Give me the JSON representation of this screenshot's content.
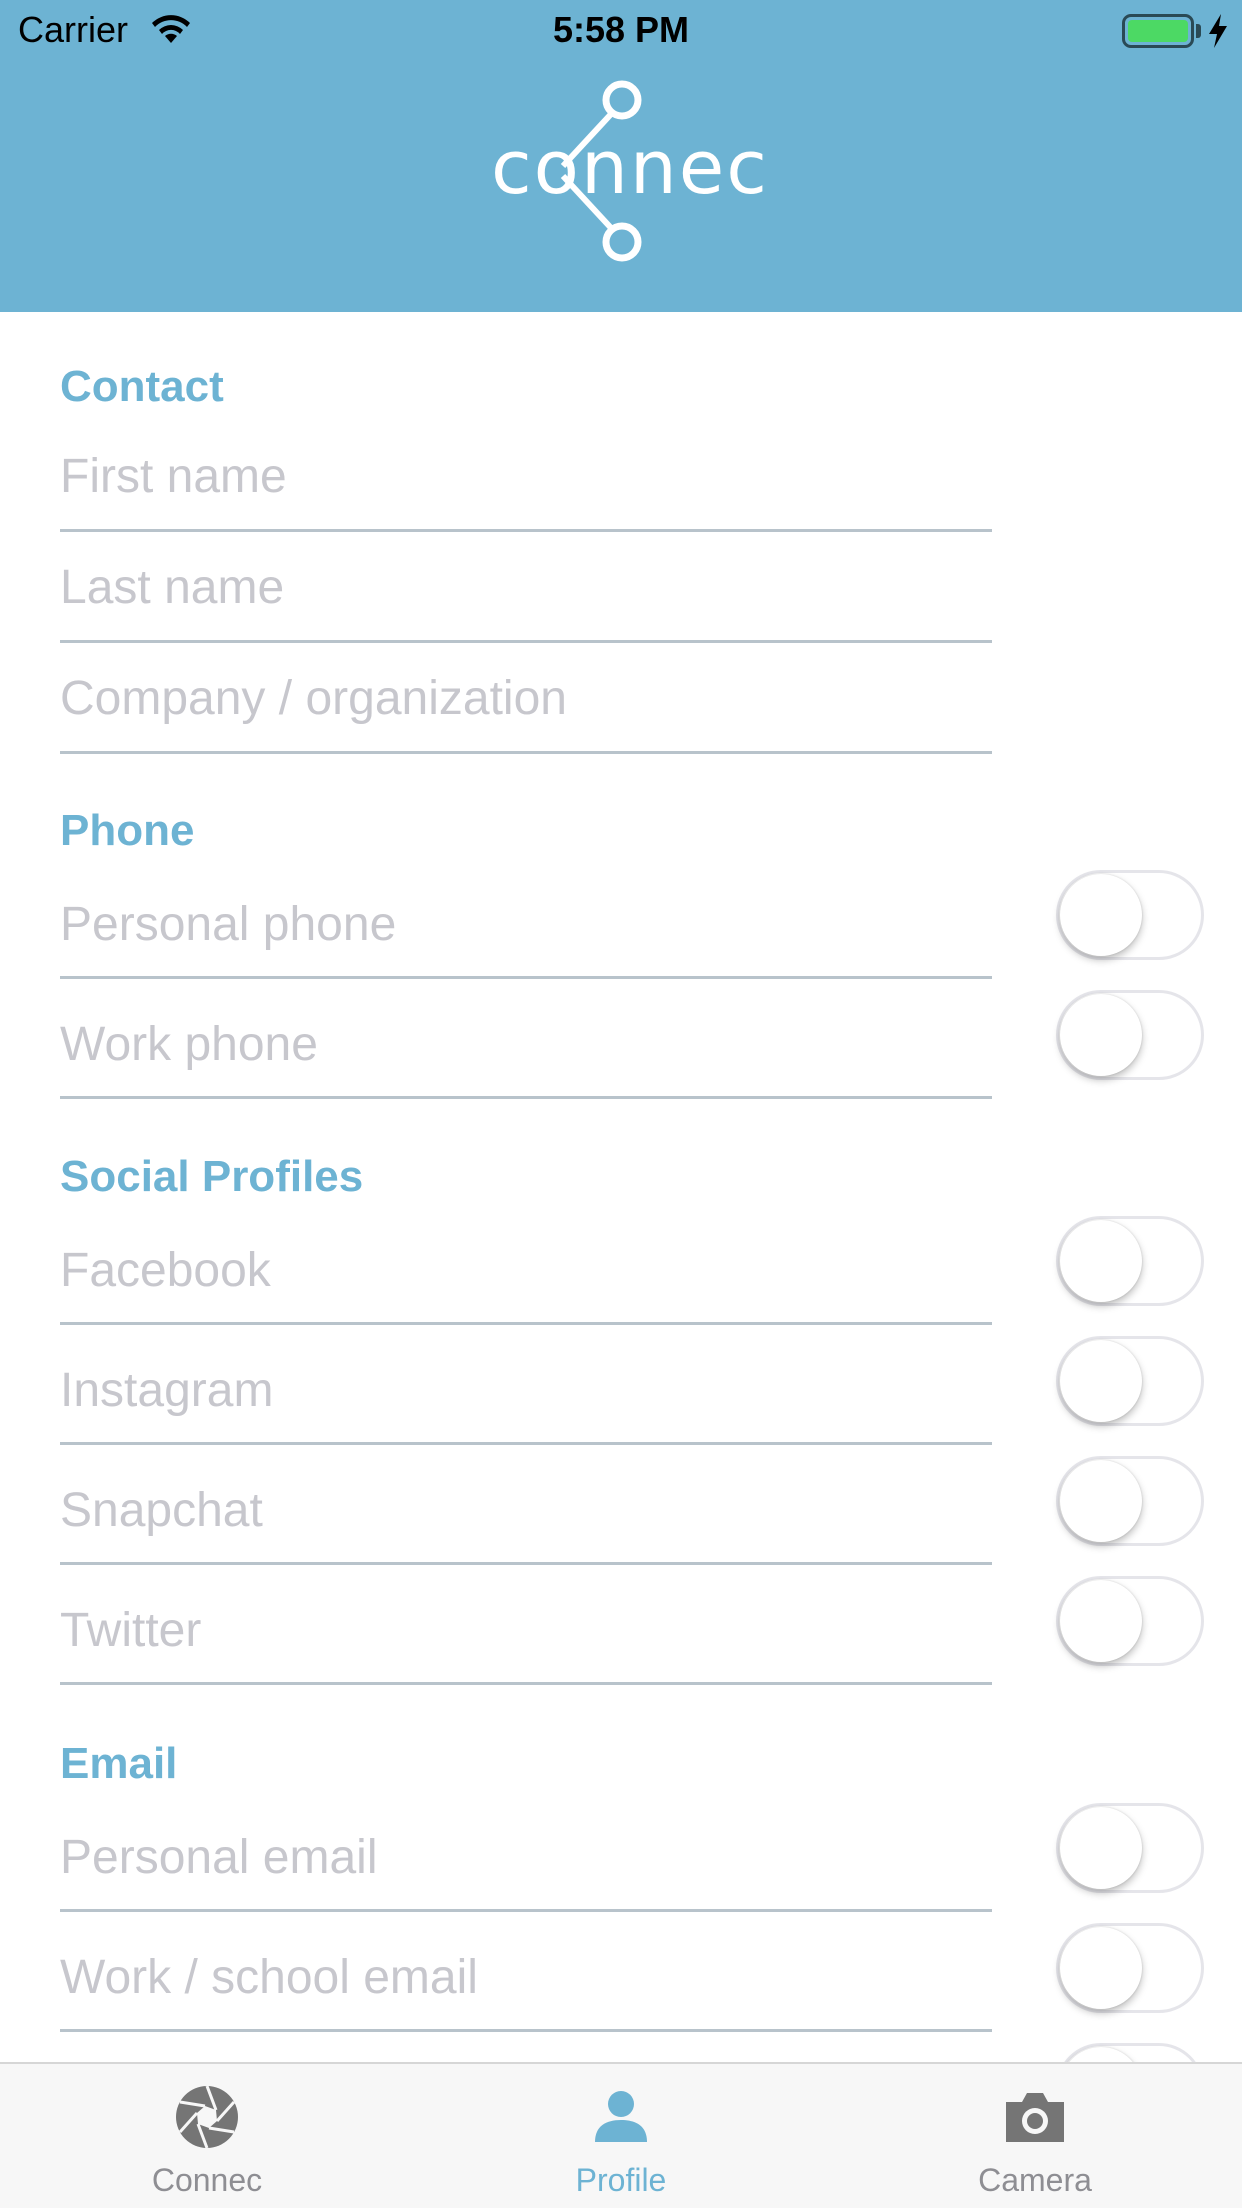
{
  "status_bar": {
    "carrier": "Carrier",
    "time": "5:58 PM"
  },
  "header": {
    "logo_text": "connec",
    "background_color": "#6db3d3"
  },
  "sections": {
    "contact": {
      "title": "Contact",
      "fields": [
        {
          "placeholder": "First name",
          "value": ""
        },
        {
          "placeholder": "Last name",
          "value": ""
        },
        {
          "placeholder": "Company / organization",
          "value": ""
        }
      ]
    },
    "phone": {
      "title": "Phone",
      "fields": [
        {
          "placeholder": "Personal phone",
          "value": "",
          "toggle_on": false
        },
        {
          "placeholder": "Work phone",
          "value": "",
          "toggle_on": false
        }
      ]
    },
    "social": {
      "title": "Social Profiles",
      "fields": [
        {
          "placeholder": "Facebook",
          "value": "",
          "toggle_on": false
        },
        {
          "placeholder": "Instagram",
          "value": "",
          "toggle_on": false
        },
        {
          "placeholder": "Snapchat",
          "value": "",
          "toggle_on": false
        },
        {
          "placeholder": "Twitter",
          "value": "",
          "toggle_on": false
        }
      ]
    },
    "email": {
      "title": "Email",
      "fields": [
        {
          "placeholder": "Personal email",
          "value": "",
          "toggle_on": false
        },
        {
          "placeholder": "Work / school email",
          "value": "",
          "toggle_on": false
        }
      ]
    }
  },
  "tabbar": {
    "tabs": [
      {
        "label": "Connec",
        "icon": "aperture-icon",
        "active": false
      },
      {
        "label": "Profile",
        "icon": "person-icon",
        "active": true
      },
      {
        "label": "Camera",
        "icon": "camera-icon",
        "active": false
      }
    ],
    "active_color": "#6db3d3",
    "inactive_color": "#8e8e93"
  }
}
